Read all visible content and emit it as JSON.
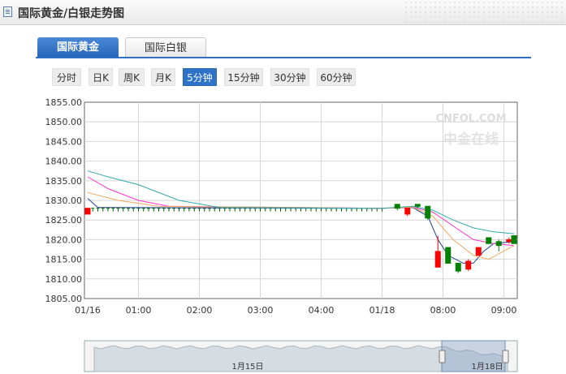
{
  "header": {
    "title": "国际黄金/白银走势图",
    "icon": "doc-icon"
  },
  "tabs": [
    {
      "label": "国际黄金",
      "active": true
    },
    {
      "label": "国际白银",
      "active": false
    }
  ],
  "periods": [
    {
      "label": "分时",
      "active": false
    },
    {
      "label": "日K",
      "active": false
    },
    {
      "label": "周K",
      "active": false
    },
    {
      "label": "月K",
      "active": false
    },
    {
      "label": "5分钟",
      "active": true
    },
    {
      "label": "15分钟",
      "active": false
    },
    {
      "label": "30分钟",
      "active": false
    },
    {
      "label": "60分钟",
      "active": false
    }
  ],
  "watermark": {
    "line1": "CNFOL.COM",
    "line2": "中金在线"
  },
  "colors": {
    "up": "#ff0000",
    "down": "#008000",
    "ma5": "#1f3f8f",
    "ma10": "#ff33cc",
    "ma20": "#f0a860",
    "ma30": "#33aaaa"
  },
  "chart_data": {
    "type": "candlestick",
    "ylim": [
      1805,
      1855
    ],
    "yticks": [
      "1855.00",
      "1850.00",
      "1845.00",
      "1840.00",
      "1835.00",
      "1830.00",
      "1825.00",
      "1820.00",
      "1815.00",
      "1810.00",
      "1805.00"
    ],
    "xticks": [
      {
        "label": "01/16",
        "i": 0
      },
      {
        "label": "01:00",
        "i": 10
      },
      {
        "label": "02:00",
        "i": 22
      },
      {
        "label": "03:00",
        "i": 34
      },
      {
        "label": "04:00",
        "i": 46
      },
      {
        "label": "01/18",
        "i": 58
      },
      {
        "label": "08:00",
        "i": 70
      },
      {
        "label": "09:00",
        "i": 82
      }
    ],
    "count": 85,
    "flat_price": 1828,
    "candles": [
      {
        "i": 0,
        "o": 1826.5,
        "h": 1828,
        "l": 1826.5,
        "c": 1828
      },
      {
        "i": 61,
        "o": 1829,
        "h": 1829,
        "l": 1827.5,
        "c": 1828
      },
      {
        "i": 63,
        "o": 1826.5,
        "h": 1828,
        "l": 1826,
        "c": 1828
      },
      {
        "i": 65,
        "o": 1829,
        "h": 1829,
        "l": 1828,
        "c": 1828.5
      },
      {
        "i": 67,
        "o": 1828.5,
        "h": 1828.5,
        "l": 1825,
        "c": 1825.5
      },
      {
        "i": 69,
        "o": 1813,
        "h": 1821,
        "l": 1813,
        "c": 1817
      },
      {
        "i": 71,
        "o": 1818,
        "h": 1818,
        "l": 1814,
        "c": 1814
      },
      {
        "i": 73,
        "o": 1814,
        "h": 1814,
        "l": 1811.5,
        "c": 1812
      },
      {
        "i": 75,
        "o": 1812.5,
        "h": 1815,
        "l": 1812,
        "c": 1814.5
      },
      {
        "i": 77,
        "o": 1816,
        "h": 1818,
        "l": 1816,
        "c": 1818
      },
      {
        "i": 79,
        "o": 1820.5,
        "h": 1820.5,
        "l": 1819,
        "c": 1819
      },
      {
        "i": 81,
        "o": 1819.5,
        "h": 1820,
        "l": 1817,
        "c": 1818.5
      },
      {
        "i": 83,
        "o": 1819.5,
        "h": 1820.5,
        "l": 1819,
        "c": 1820
      },
      {
        "i": 84,
        "o": 1821,
        "h": 1821,
        "l": 1819,
        "c": 1819
      }
    ],
    "series": [
      {
        "key": "ma5",
        "points": [
          [
            0,
            1830.5
          ],
          [
            2,
            1828.2
          ],
          [
            58,
            1828
          ],
          [
            64,
            1828.2
          ],
          [
            67,
            1826
          ],
          [
            69,
            1820
          ],
          [
            71,
            1816
          ],
          [
            74,
            1814
          ],
          [
            76,
            1814
          ],
          [
            78,
            1817
          ],
          [
            80,
            1819
          ],
          [
            84,
            1819.5
          ]
        ]
      },
      {
        "key": "ma10",
        "points": [
          [
            0,
            1836
          ],
          [
            4,
            1833
          ],
          [
            10,
            1830
          ],
          [
            16,
            1828.5
          ],
          [
            58,
            1828
          ],
          [
            64,
            1828.3
          ],
          [
            68,
            1827
          ],
          [
            72,
            1823.5
          ],
          [
            76,
            1820
          ],
          [
            80,
            1819
          ],
          [
            84,
            1818.5
          ]
        ]
      },
      {
        "key": "ma20",
        "points": [
          [
            0,
            1832
          ],
          [
            6,
            1830
          ],
          [
            14,
            1828.5
          ],
          [
            58,
            1828
          ],
          [
            64,
            1828.3
          ],
          [
            68,
            1826
          ],
          [
            72,
            1820
          ],
          [
            76,
            1816
          ],
          [
            79,
            1815
          ],
          [
            84,
            1818.5
          ]
        ]
      },
      {
        "key": "ma30",
        "points": [
          [
            0,
            1837.5
          ],
          [
            4,
            1836
          ],
          [
            10,
            1834
          ],
          [
            18,
            1830
          ],
          [
            26,
            1828.2
          ],
          [
            58,
            1828
          ],
          [
            64,
            1828.5
          ],
          [
            68,
            1827.5
          ],
          [
            72,
            1825
          ],
          [
            76,
            1823
          ],
          [
            80,
            1822
          ],
          [
            84,
            1821.5
          ]
        ]
      }
    ],
    "navigator": {
      "labels": [
        "1月15日",
        "1月18日"
      ]
    }
  }
}
